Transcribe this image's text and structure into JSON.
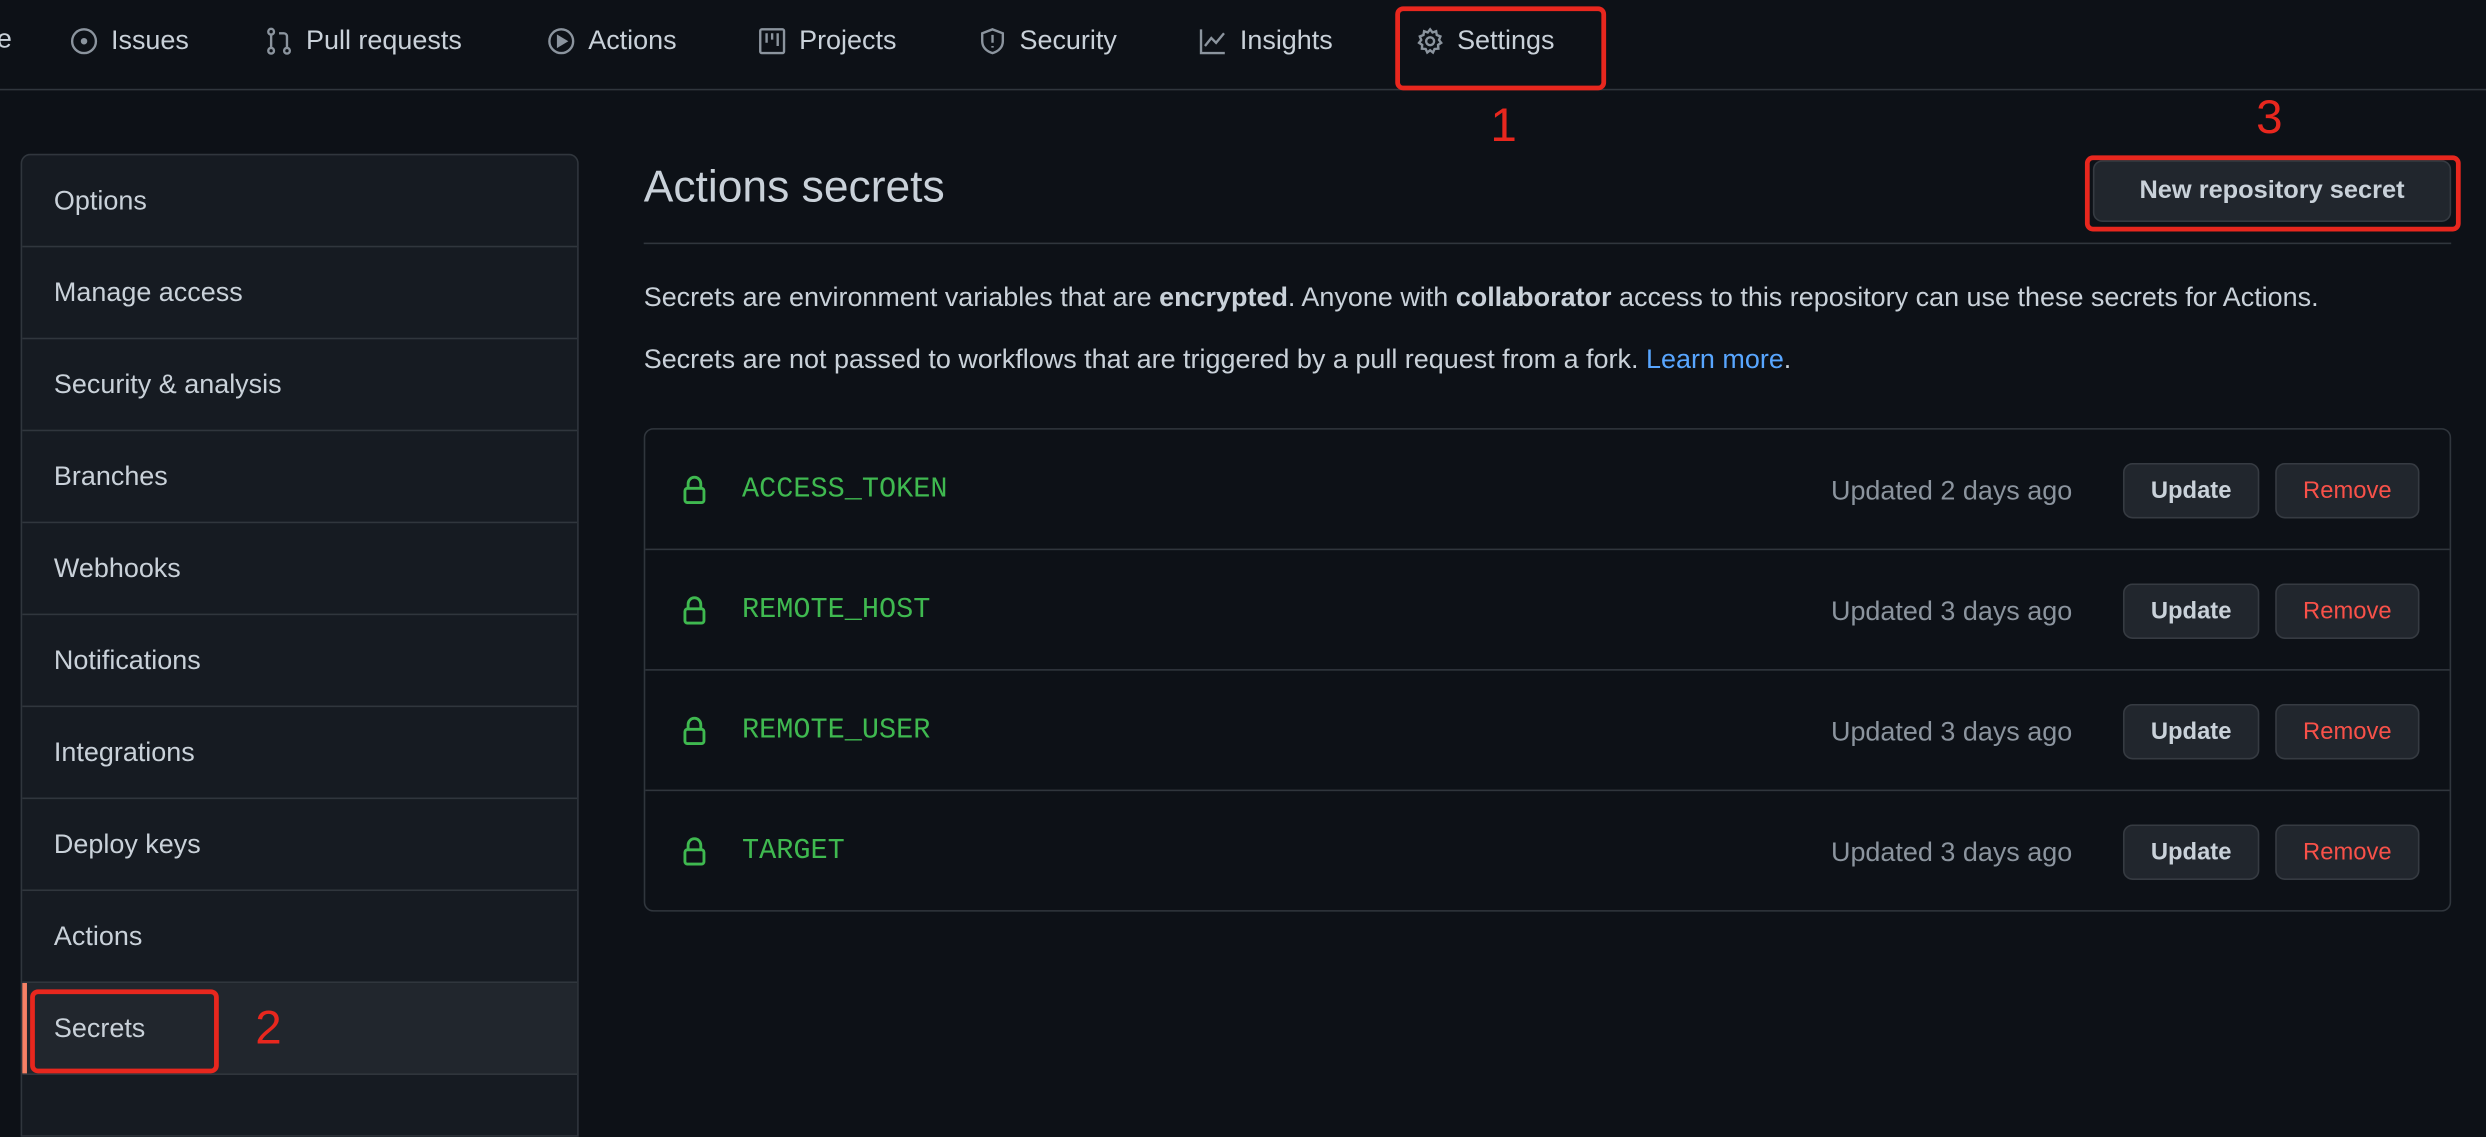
{
  "nav": {
    "partial_left": "e",
    "items": [
      {
        "label": "Issues",
        "icon": "issue-opened-icon"
      },
      {
        "label": "Pull requests",
        "icon": "git-pull-request-icon"
      },
      {
        "label": "Actions",
        "icon": "play-icon"
      },
      {
        "label": "Projects",
        "icon": "project-icon"
      },
      {
        "label": "Security",
        "icon": "shield-icon"
      },
      {
        "label": "Insights",
        "icon": "graph-icon"
      },
      {
        "label": "Settings",
        "icon": "gear-icon"
      }
    ]
  },
  "sidebar": {
    "items": [
      {
        "label": "Options"
      },
      {
        "label": "Manage access"
      },
      {
        "label": "Security & analysis"
      },
      {
        "label": "Branches"
      },
      {
        "label": "Webhooks"
      },
      {
        "label": "Notifications"
      },
      {
        "label": "Integrations"
      },
      {
        "label": "Deploy keys"
      },
      {
        "label": "Actions"
      },
      {
        "label": "Secrets",
        "selected": true
      }
    ]
  },
  "main": {
    "title": "Actions secrets",
    "new_secret_label": "New repository secret",
    "para1": {
      "a": "Secrets are environment variables that are ",
      "b": "encrypted",
      "c": ". Anyone with ",
      "d": "collaborator",
      "e": " access to this repository can use these secrets for Actions."
    },
    "para2": {
      "a": "Secrets are not passed to workflows that are triggered by a pull request from a fork. ",
      "link": "Learn more",
      "c": "."
    },
    "secrets": [
      {
        "name": "ACCESS_TOKEN",
        "updated": "Updated 2 days ago"
      },
      {
        "name": "REMOTE_HOST",
        "updated": "Updated 3 days ago"
      },
      {
        "name": "REMOTE_USER",
        "updated": "Updated 3 days ago"
      },
      {
        "name": "TARGET",
        "updated": "Updated 3 days ago"
      }
    ],
    "update_label": "Update",
    "remove_label": "Remove"
  },
  "annotations": {
    "one": "1",
    "two": "2",
    "three": "3"
  },
  "colors": {
    "background": "#0d1117",
    "border": "#30363d",
    "secret_name": "#3fb950",
    "danger": "#f85149",
    "link": "#58a6ff",
    "annotation": "#e8271e",
    "selected_marker": "#f78166"
  }
}
